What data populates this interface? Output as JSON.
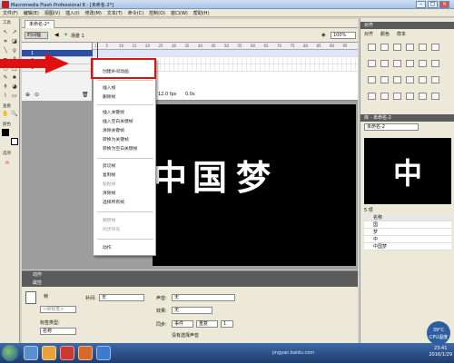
{
  "window": {
    "title": "Macromedia Flash Professional 8 - [未命名-2*]"
  },
  "menu": [
    "文件(F)",
    "编辑(E)",
    "视图(V)",
    "插入(I)",
    "修改(M)",
    "文本(T)",
    "命令(C)",
    "控制(O)",
    "窗口(W)",
    "帮助(H)"
  ],
  "tools": {
    "header": "工具",
    "view_label": "查看",
    "color_label": "颜色",
    "options_label": "选项"
  },
  "document": {
    "tab": "未命名-2*",
    "timeline_button": "时间轴",
    "scene": "场景 1",
    "zoom": "100%"
  },
  "timeline": {
    "layers": [
      {
        "name": "1",
        "selected": true
      },
      {
        "name": "2",
        "selected": false
      },
      {
        "name": "3",
        "selected": false
      }
    ],
    "ruler": [
      "1",
      "5",
      "10",
      "15",
      "20",
      "25",
      "30",
      "35",
      "40",
      "45",
      "50",
      "55",
      "60",
      "65",
      "70",
      "75",
      "80",
      "85",
      "90",
      "95"
    ],
    "fps": "12.0 fps",
    "time": "0.0s"
  },
  "stage_text": [
    "中",
    "国",
    "梦"
  ],
  "context_menu": {
    "items": [
      {
        "label": "创建补间动画",
        "disabled": false
      },
      {
        "label": "插入帧",
        "disabled": false
      },
      {
        "label": "删除帧",
        "disabled": false
      },
      {
        "label": "插入关键帧",
        "disabled": false
      },
      {
        "label": "插入空白关键帧",
        "disabled": false
      },
      {
        "label": "清除关键帧",
        "disabled": false
      },
      {
        "label": "转换为关键帧",
        "disabled": false
      },
      {
        "label": "转换为空白关键帧",
        "disabled": false
      },
      {
        "label": "剪切帧",
        "disabled": false
      },
      {
        "label": "复制帧",
        "disabled": false
      },
      {
        "label": "粘贴帧",
        "disabled": true
      },
      {
        "label": "清除帧",
        "disabled": false
      },
      {
        "label": "选择所有帧",
        "disabled": false
      },
      {
        "label": "翻转帧",
        "disabled": true
      },
      {
        "label": "同步符号",
        "disabled": true
      },
      {
        "label": "动作",
        "disabled": false
      }
    ]
  },
  "right_panel": {
    "align_header": "对齐",
    "tabs": [
      "对齐",
      "颜色",
      "样本"
    ],
    "library_header": "库 - 未命名-2",
    "library_select": "未命名-2",
    "library_count": "5 项",
    "library_items": [
      "名称",
      "国",
      "梦",
      "中",
      "中国梦"
    ]
  },
  "properties": {
    "header_tabs": [
      "动作",
      "属性"
    ],
    "frame_label": "帧",
    "frame_placeholder": "<帧标签>",
    "label_type": "标签类型:",
    "label_type_value": "名称",
    "tween_label": "补间:",
    "tween_value": "无",
    "sound_label": "声音:",
    "sound_value": "无",
    "effect_label": "效果:",
    "effect_value": "无",
    "sync_label": "同步:",
    "sync_value": "事件",
    "repeat_value": "重复",
    "repeat_count": "1",
    "nosound": "没有选择声音"
  },
  "taskbar": {
    "time": "23:41",
    "date": "2016/1/29",
    "temp": "39°C",
    "temp_label": "CPU温度",
    "watermark": "jingyan.baidu.com"
  },
  "colors": {
    "accent_red": "#e01010",
    "stage": "#000000",
    "selected_layer": "#2c4fa6"
  }
}
